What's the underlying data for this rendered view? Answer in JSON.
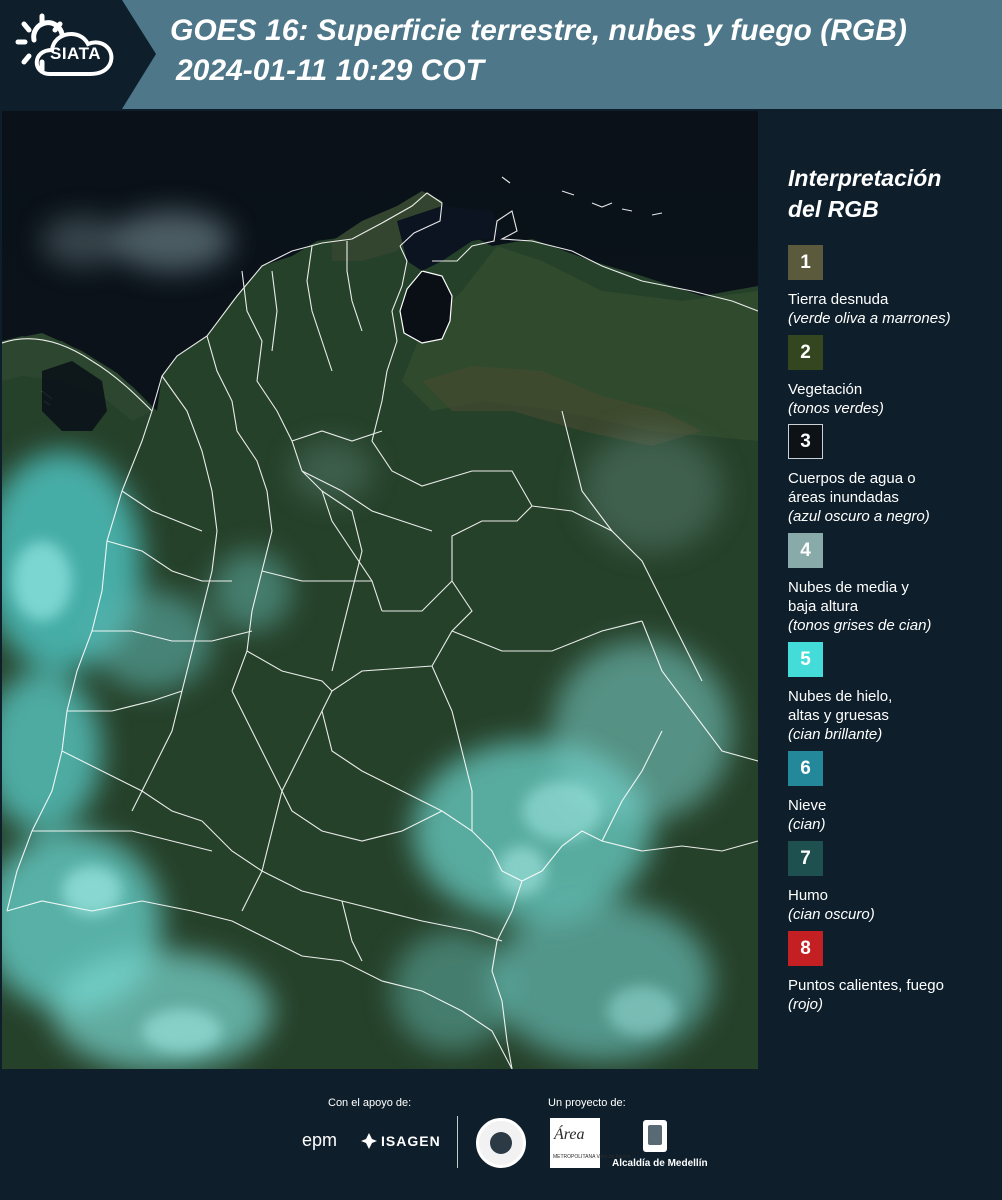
{
  "header": {
    "logo_text": "SIATA",
    "title_line1": "GOES 16: Superficie terrestre, nubes y fuego (RGB)",
    "title_line2": "2024-01-11 10:29 COT"
  },
  "map": {
    "region": "Colombia",
    "layers": [
      "satellite-rgb",
      "department-borders",
      "coastline"
    ]
  },
  "legend": {
    "title_line1": "Interpretación",
    "title_line2": "del RGB",
    "items": [
      {
        "number": "1",
        "color": "#5b5a3c",
        "label": "Tierra desnuda",
        "label2": "",
        "desc": "(verde oliva a marrones)"
      },
      {
        "number": "2",
        "color": "#34461f",
        "label": "Vegetación",
        "label2": "",
        "desc": "(tonos verdes)"
      },
      {
        "number": "3",
        "color": "#0d1216",
        "label": "Cuerpos de agua o",
        "label2": "áreas inundadas",
        "desc": "(azul oscuro a negro)"
      },
      {
        "number": "4",
        "color": "#88aaa8",
        "label": "Nubes de media y",
        "label2": "baja altura",
        "desc": "(tonos grises de cian)"
      },
      {
        "number": "5",
        "color": "#43dcd8",
        "label": "Nubes de hielo,",
        "label2": "altas y gruesas",
        "desc": "(cian brillante)"
      },
      {
        "number": "6",
        "color": "#23889a",
        "label": "Nieve",
        "label2": "",
        "desc": "(cian)"
      },
      {
        "number": "7",
        "color": "#1f5050",
        "label": "Humo",
        "label2": "",
        "desc": "(cian oscuro)"
      },
      {
        "number": "8",
        "color": "#c42024",
        "label": "Puntos calientes, fuego",
        "label2": "",
        "desc": "(rojo)"
      }
    ]
  },
  "footer": {
    "support_label": "Con el apoyo de:",
    "project_label": "Un proyecto de:",
    "epm": "epm",
    "isagen": "ISAGEN",
    "area_logo": "Área",
    "area_sub": "METROPOLITANA Valle de Aburrá",
    "alcaldia": "Alcaldía de Medellín"
  }
}
